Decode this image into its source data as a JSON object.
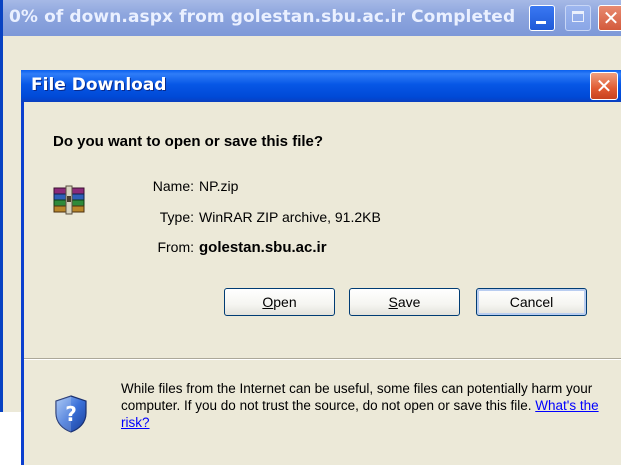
{
  "background_window": {
    "title": "0% of down.aspx from golestan.sbu.ac.ir Completed",
    "close_glyph": "✕"
  },
  "dialog": {
    "title": "File Download",
    "close_glyph": "✕",
    "question": "Do you want to open or save this file?",
    "file": {
      "icon": "winrar-archive-icon",
      "name_label": "Name:",
      "name_value": "NP.zip",
      "type_label": "Type:",
      "type_value": "WinRAR ZIP archive, 91.2KB",
      "from_label": "From:",
      "from_value": "golestan.sbu.ac.ir"
    },
    "buttons": {
      "open_mnemonic": "O",
      "open_rest": "pen",
      "save_mnemonic": "S",
      "save_rest": "ave",
      "cancel_label": "Cancel"
    },
    "warning": {
      "icon": "security-shield-question-icon",
      "text": "While files from the Internet can be useful, some files can potentially harm your computer. If you do not trust the source, do not open or save this file.",
      "link": "What's the risk?"
    },
    "colors": {
      "titlebar_blue": "#0757e6",
      "face": "#ece9d8",
      "link": "#0000ff",
      "close_red": "#e05a32"
    }
  }
}
